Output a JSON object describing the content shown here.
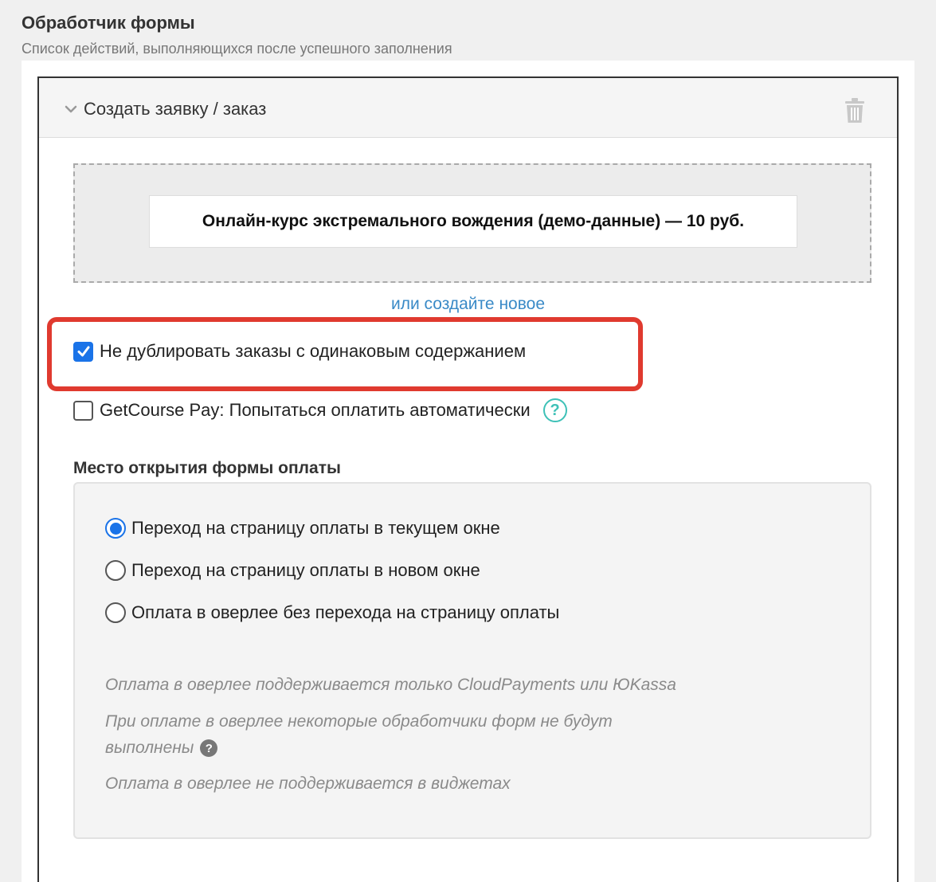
{
  "header": {
    "title": "Обработчик формы",
    "subtitle": "Список действий, выполняющихся после успешного заполнения"
  },
  "action": {
    "title": "Создать заявку / заказ",
    "product": "Онлайн-курс экстремального вождения (демо-данные) — 10 руб.",
    "create_new_link": "или создайте новое",
    "no_duplicate": {
      "label": "Не дублировать заказы с одинаковым содержанием",
      "checked": true
    },
    "getcourse_pay": {
      "label": "GetCourse Pay: Попытаться оплатить автоматически",
      "checked": false
    },
    "help_glyph": "?"
  },
  "payment_form": {
    "title": "Место открытия формы оплаты",
    "options": [
      {
        "label": "Переход на страницу оплаты в текущем окне",
        "selected": true
      },
      {
        "label": "Переход на страницу оплаты в новом окне",
        "selected": false
      },
      {
        "label": "Оплата в оверлее без перехода на страницу оплаты",
        "selected": false
      }
    ],
    "notes": {
      "line1": "Оплата в оверлее поддерживается только CloudPayments или ЮKassa",
      "line2a": "При оплате в оверлее некоторые обработчики форм не будут",
      "line2b": "выполнены",
      "line3": "Оплата в оверлее не поддерживается в виджетах"
    },
    "help_glyph": "?"
  },
  "colors": {
    "accent": "#1a73e8",
    "link": "#3a8ac7",
    "highlight": "#e03a2f",
    "help": "#3ec1b7"
  },
  "icons": [
    "chevron-down-icon",
    "trash-icon",
    "checkmark-icon",
    "help-icon"
  ]
}
